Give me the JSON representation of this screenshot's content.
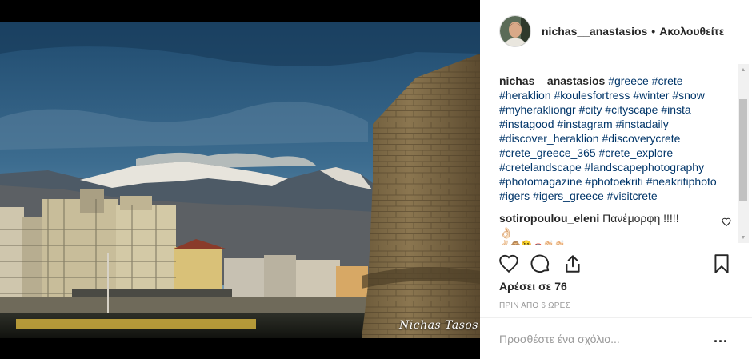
{
  "post": {
    "username": "nichas__anastasios",
    "separator": "•",
    "follow_label": "Ακολουθείτε",
    "watermark": "Nichas Tasos"
  },
  "caption": {
    "username": "nichas__anastasios",
    "hashtags": [
      "#greece",
      "#crete",
      "#heraklion",
      "#koulesfortress",
      "#winter",
      "#snow",
      "#myherakliongr",
      "#city",
      "#cityscape",
      "#insta",
      "#instagood",
      "#instagram",
      "#instadaily",
      "#discover_heraklion",
      "#discoverycrete",
      "#crete_greece_365",
      "#crete_explore",
      "#cretelandscape",
      "#landscapephotography",
      "#photomagazine",
      "#photoekriti",
      "#neakritiphoto",
      "#igers",
      "#igers_greece",
      "#visitcrete"
    ]
  },
  "comment": {
    "username": "sotiropoulou_eleni",
    "text": "Πανέμορφη !!!!! 👌🏻",
    "emojis": "✌🏻🙈😘🚗👏🏻👏🏻"
  },
  "actions": {
    "like_icon": "heart-icon",
    "comment_icon": "comment-bubble-icon",
    "share_icon": "share-icon",
    "save_icon": "bookmark-icon"
  },
  "likes_text": "Αρέσει σε 76",
  "timestamp": "ΠΡΙΝ ΑΠΟ 6 ΩΡΕΣ",
  "add_comment": {
    "placeholder": "Προσθέστε ένα σχόλιο...",
    "more_label": "..."
  },
  "colors": {
    "hashtag": "#003569",
    "text": "#262626",
    "muted": "#999999",
    "border": "#efefef"
  }
}
